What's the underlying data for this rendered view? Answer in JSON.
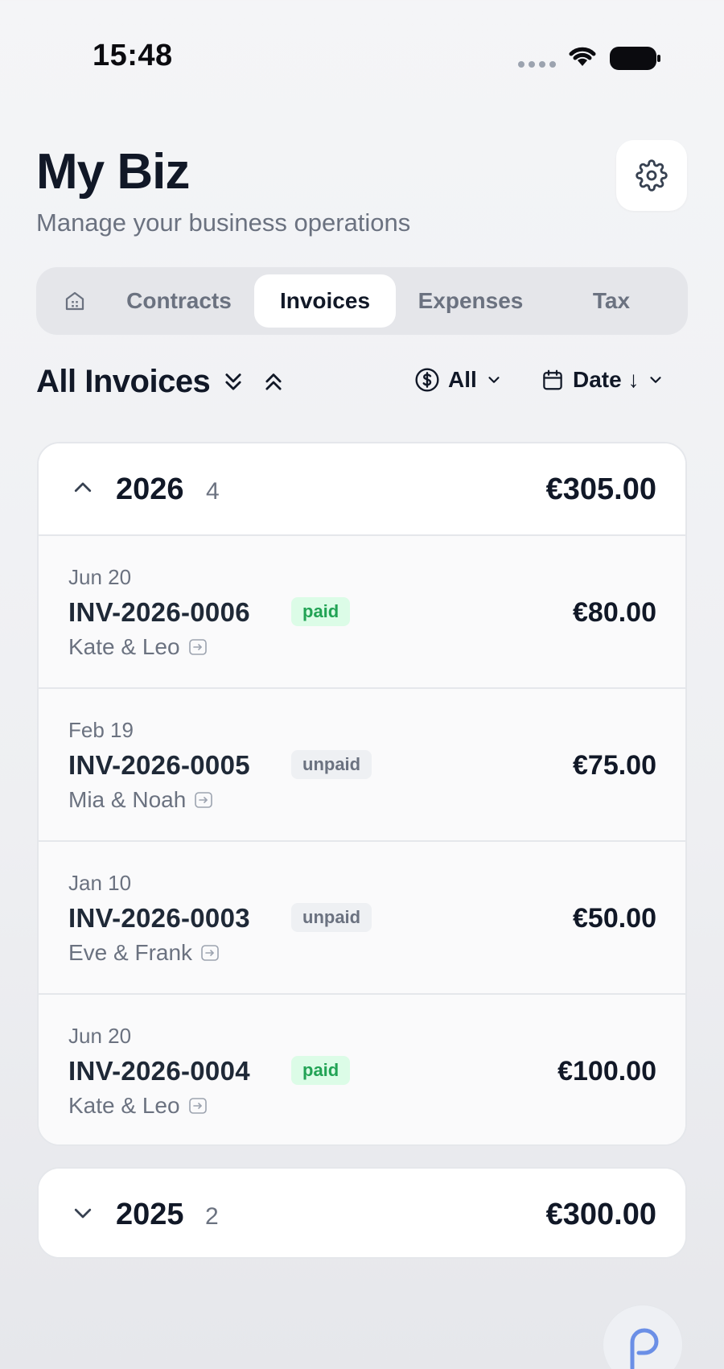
{
  "status_bar": {
    "time": "15:48"
  },
  "header": {
    "title": "My Biz",
    "subtitle": "Manage your business operations"
  },
  "tabs": [
    {
      "label": "",
      "icon": "home-icon"
    },
    {
      "label": "Contracts"
    },
    {
      "label": "Invoices",
      "active": true
    },
    {
      "label": "Expenses"
    },
    {
      "label": "Tax"
    }
  ],
  "toolbar": {
    "title": "All Invoices",
    "status_filter": {
      "icon": "dollar-circle-icon",
      "value": "All"
    },
    "sort": {
      "icon": "calendar-icon",
      "value": "Date ↓"
    }
  },
  "years": [
    {
      "year": "2026",
      "count": "4",
      "total": "€305.00",
      "expanded": true,
      "invoices": [
        {
          "date": "Jun 20",
          "number": "INV-2026-0006",
          "status": "paid",
          "client": "Kate & Leo",
          "amount": "€80.00"
        },
        {
          "date": "Feb 19",
          "number": "INV-2026-0005",
          "status": "unpaid",
          "client": "Mia & Noah",
          "amount": "€75.00"
        },
        {
          "date": "Jan 10",
          "number": "INV-2026-0003",
          "status": "unpaid",
          "client": "Eve & Frank",
          "amount": "€50.00"
        },
        {
          "date": "Jun 20",
          "number": "INV-2026-0004",
          "status": "paid",
          "client": "Kate & Leo",
          "amount": "€100.00"
        }
      ]
    },
    {
      "year": "2025",
      "count": "2",
      "total": "€300.00",
      "expanded": false
    }
  ],
  "colors": {
    "paid": "#22a355",
    "paid_bg": "#dcfce7",
    "unpaid": "#6b7280",
    "fab_accent": "#6b8fe6"
  }
}
